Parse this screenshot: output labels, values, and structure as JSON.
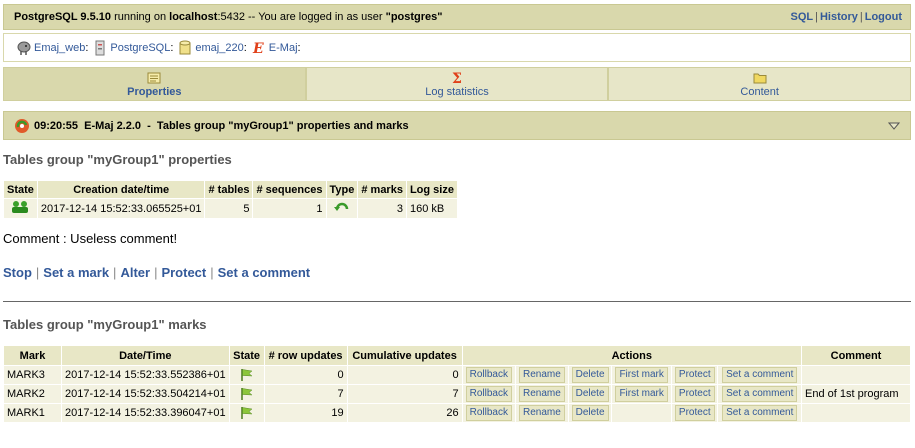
{
  "topbar": {
    "server": "PostgreSQL 9.5.10",
    "running_on": "running on",
    "host": "localhost",
    "port": ":5432 -- You are logged in as user",
    "user": "\"postgres\"",
    "links": [
      "SQL",
      "History",
      "Logout"
    ]
  },
  "trail": [
    {
      "label": "Emaj_web",
      "icon": "elephant-icon"
    },
    {
      "label": "PostgreSQL",
      "icon": "server-icon"
    },
    {
      "label": "emaj_220",
      "icon": "database-icon"
    },
    {
      "label": "E-Maj",
      "icon": "emaj-icon"
    }
  ],
  "tabs": [
    {
      "label": "Properties",
      "icon": "properties-icon",
      "active": true
    },
    {
      "label": "Log statistics",
      "icon": "sigma-icon",
      "active": false
    },
    {
      "label": "Content",
      "icon": "folder-icon",
      "active": false
    }
  ],
  "section": {
    "time": "09:20:55",
    "version": "E-Maj 2.2.0",
    "title": "Tables group \"myGroup1\" properties and marks"
  },
  "properties": {
    "heading": "Tables group \"myGroup1\" properties",
    "columns": [
      "State",
      "Creation date/time",
      "# tables",
      "# sequences",
      "Type",
      "# marks",
      "Log size"
    ],
    "row": {
      "state_icon": "started-icon",
      "created": "2017-12-14 15:52:33.065525+01",
      "tables": "5",
      "sequences": "1",
      "type_icon": "rollbackable-icon",
      "marks": "3",
      "log_size": "160 kB"
    }
  },
  "comment": "Comment : Useless comment!",
  "group_actions": [
    "Stop",
    "Set a mark",
    "Alter",
    "Protect",
    "Set a comment"
  ],
  "marks": {
    "heading": "Tables group \"myGroup1\" marks",
    "columns": [
      "Mark",
      "Date/Time",
      "State",
      "# row updates",
      "Cumulative updates",
      "Actions",
      "Comment"
    ],
    "rows": [
      {
        "mark": "MARK3",
        "datetime": "2017-12-14 15:52:33.552386+01",
        "row_updates": "0",
        "cumulative": "0",
        "actions": [
          "Rollback",
          "Rename",
          "Delete",
          "First mark",
          "Protect",
          "Set a comment"
        ],
        "comment": ""
      },
      {
        "mark": "MARK2",
        "datetime": "2017-12-14 15:52:33.504214+01",
        "row_updates": "7",
        "cumulative": "7",
        "actions": [
          "Rollback",
          "Rename",
          "Delete",
          "First mark",
          "Protect",
          "Set a comment"
        ],
        "comment": "End of 1st program"
      },
      {
        "mark": "MARK1",
        "datetime": "2017-12-14 15:52:33.396047+01",
        "row_updates": "19",
        "cumulative": "26",
        "actions": [
          "Rollback",
          "Rename",
          "Delete",
          "",
          "Protect",
          "Set a comment"
        ],
        "comment": ""
      }
    ]
  },
  "colors": {
    "bar": "#d9d8ac",
    "link": "#335999",
    "cell": "#f3f2e1",
    "header": "#e8e7c6"
  }
}
